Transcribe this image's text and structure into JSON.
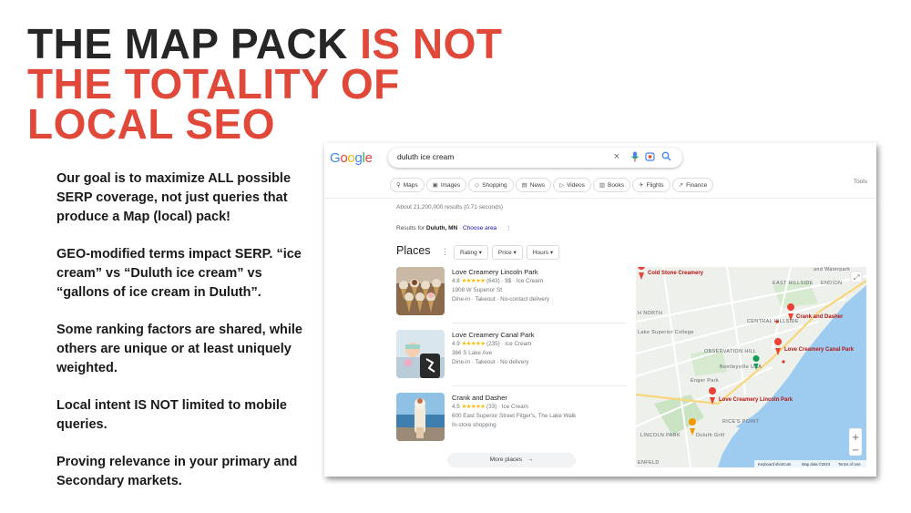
{
  "slide": {
    "title_dark": "THE MAP PACK ",
    "title_red_1": "IS NOT",
    "title_red_2": "THE TOTALITY OF",
    "title_red_3": "LOCAL SEO",
    "bullets": [
      "Our goal is to maximize ALL possible SERP coverage, not just queries that produce a Map (local) pack!",
      "GEO-modified terms impact SERP. “ice cream” vs “Duluth ice cream” vs “gallons of ice cream in Duluth”.",
      "Some ranking factors are shared, while others are unique or at least uniquely weighted.",
      "Local intent IS NOT limited to mobile queries.",
      "Proving relevance in your primary and Secondary markets."
    ]
  },
  "serp": {
    "logo": [
      "G",
      "o",
      "o",
      "g",
      "l",
      "e"
    ],
    "logo_colors": [
      "#4285f4",
      "#ea4335",
      "#fbbc05",
      "#4285f4",
      "#34a853",
      "#ea4335"
    ],
    "query": "duluth ice cream",
    "chips": [
      {
        "icon": "⚲",
        "label": "Maps"
      },
      {
        "icon": "▣",
        "label": "Images"
      },
      {
        "icon": "◇",
        "label": "Shopping"
      },
      {
        "icon": "▤",
        "label": "News"
      },
      {
        "icon": "▷",
        "label": "Videos"
      },
      {
        "icon": "▥",
        "label": "Books"
      },
      {
        "icon": "✈",
        "label": "Flights"
      },
      {
        "icon": "↗",
        "label": "Finance"
      }
    ],
    "tools": "Tools",
    "about": "About 21,200,000 results (0.71 seconds)",
    "results_for_prefix": "Results for ",
    "results_for_location": "Duluth, MN",
    "results_for_sep": " · ",
    "results_for_link": "Choose area",
    "places_heading": "Places",
    "filters": [
      "Rating",
      "Price",
      "Hours"
    ],
    "places": [
      {
        "name": "Love Creamery Lincoln Park",
        "rating": "4.8",
        "stars": "★★★★★",
        "reviews": "(643)",
        "extra": " · $$ · Ice Cream",
        "address": "1908 W Superior St",
        "services": "Dine-in · Takeout · No-contact delivery"
      },
      {
        "name": "Love Creamery Canal Park",
        "rating": "4.9",
        "stars": "★★★★★",
        "reviews": "(235)",
        "extra": " · Ice Cream",
        "address": "366 S Lake Ave",
        "services": "Dine-in · Takeout · No delivery"
      },
      {
        "name": "Crank and Dasher",
        "rating": "4.5",
        "stars": "★★★★★",
        "reviews": "(33)",
        "extra": " · Ice Cream",
        "address": "600 East Superior Street Fitger's, The Lake Walk",
        "services": "In-store shopping"
      }
    ],
    "more_places": "More places",
    "map": {
      "labels": [
        "EAST HILLSIDE",
        "ENDION",
        "CENTRAL HILLSIDE",
        "OBSERVATION HILL",
        "Lake Superior College",
        "Enger Park",
        "LINCOLN PARK",
        "RICE'S POINT",
        "and Waterpark",
        "Bentleyville USA",
        "Duluth Grill",
        "ENFELD",
        "H NORTH"
      ],
      "pins": [
        "Cold Stone Creamery",
        "Crank and Dasher",
        "Love Creamery Canal Park",
        "Love Creamery Lincoln Park"
      ],
      "attribution": [
        "Keyboard shortcuts",
        "Map data ©2023",
        "Terms of Use"
      ],
      "zoom_in": "+",
      "zoom_out": "−",
      "fullscreen": "⤢"
    }
  }
}
